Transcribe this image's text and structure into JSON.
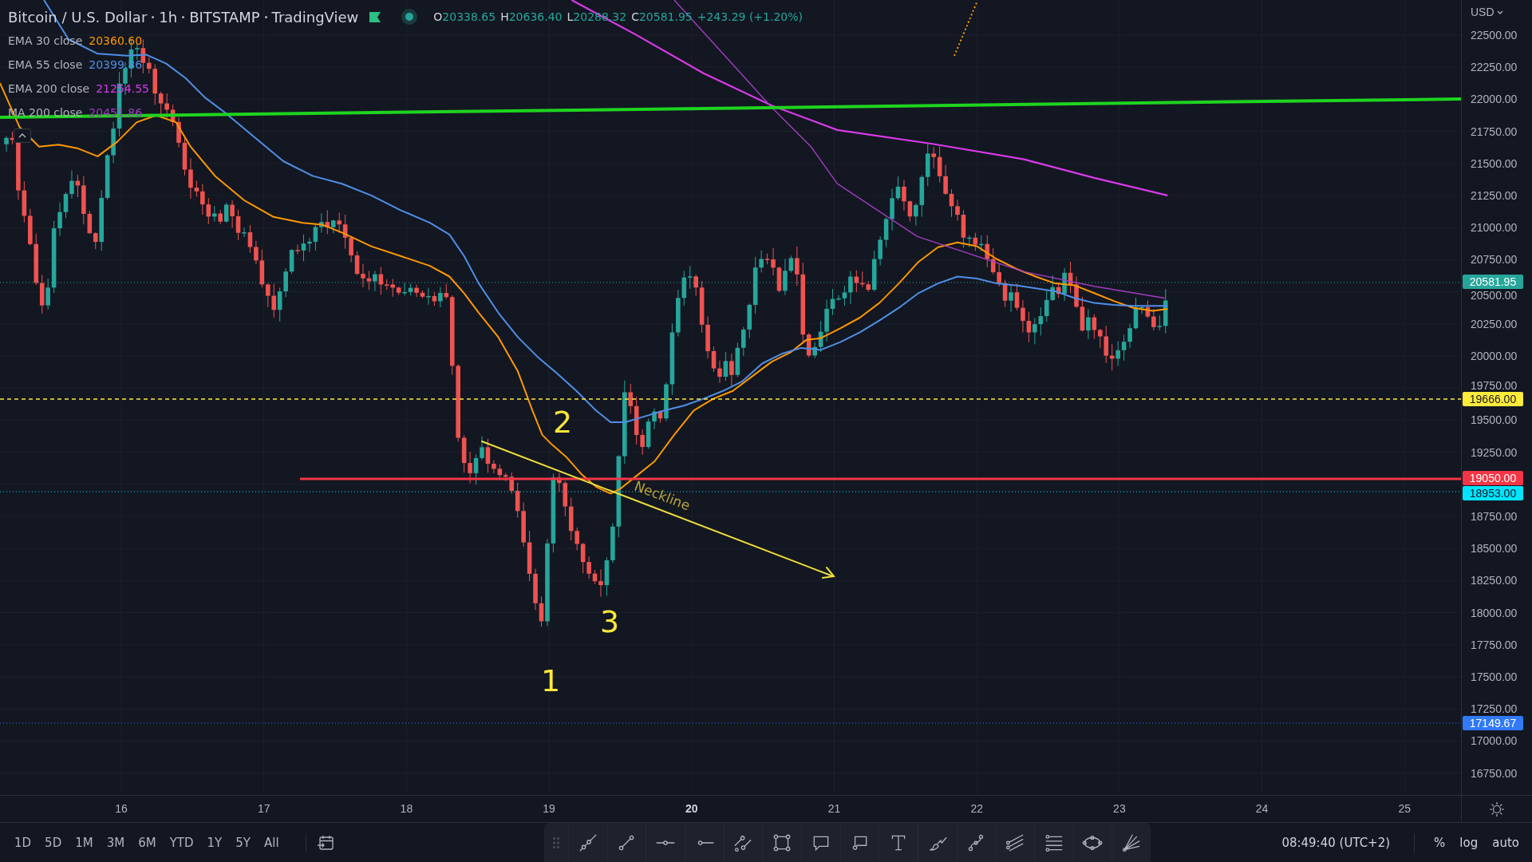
{
  "header": {
    "symbol": "Bitcoin / U.S. Dollar",
    "interval": "1h",
    "exchange": "BITSTAMP",
    "source": "TradingView",
    "rising": true,
    "ohlc": [
      {
        "label": "O",
        "value": "20338.65"
      },
      {
        "label": "H",
        "value": "20636.40"
      },
      {
        "label": "L",
        "value": "20288.32"
      },
      {
        "label": "C",
        "value": "20581.95"
      }
    ],
    "change": "+243.29 (+1.20%)"
  },
  "indicators": [
    {
      "name": "EMA 30 close",
      "value": "20360.60",
      "color": "#ff9800"
    },
    {
      "name": "EMA 55 close",
      "value": "20399.86",
      "color": "#4f8fe6"
    },
    {
      "name": "EMA 200 close",
      "value": "21254.55",
      "color": "#d93ae8"
    },
    {
      "name": "MA 200 close",
      "value": "20451.86",
      "color": "#a13cc0"
    }
  ],
  "annotations": [
    {
      "kind": "number",
      "text": "2"
    },
    {
      "kind": "label",
      "text": "Neckline"
    },
    {
      "kind": "number",
      "text": "3"
    },
    {
      "kind": "number",
      "text": "1"
    }
  ],
  "price_axis": {
    "currency": "USD",
    "labels": [
      "22500.00",
      "22250.00",
      "22000.00",
      "21750.00",
      "21500.00",
      "21250.00",
      "21000.00",
      "20750.00",
      "20500.00",
      "20250.00",
      "20000.00",
      "19750.00",
      "19500.00",
      "19250.00",
      "18750.00",
      "18500.00",
      "18250.00",
      "18000.00",
      "17750.00",
      "17500.00",
      "17250.00",
      "17000.00",
      "16750.00"
    ]
  },
  "price_tags": [
    {
      "value": "20581.95",
      "color": "#26a69a"
    },
    {
      "value": "19666.00",
      "color": "#ffeb3b"
    },
    {
      "value": "19050.00",
      "color": "#f23645"
    },
    {
      "value": "18953.00",
      "color": "#00e5ff"
    },
    {
      "value": "17149.67",
      "color": "#3179f5"
    }
  ],
  "time_axis": {
    "labels": [
      {
        "text": "16",
        "emphasized": false
      },
      {
        "text": "17",
        "emphasized": false
      },
      {
        "text": "18",
        "emphasized": false
      },
      {
        "text": "19",
        "emphasized": false
      },
      {
        "text": "20",
        "emphasized": true
      },
      {
        "text": "21",
        "emphasized": false
      },
      {
        "text": "22",
        "emphasized": false
      },
      {
        "text": "23",
        "emphasized": false
      },
      {
        "text": "24",
        "emphasized": false
      },
      {
        "text": "25",
        "emphasized": false
      }
    ]
  },
  "toolbar": {
    "ranges": [
      "1D",
      "5D",
      "1M",
      "3M",
      "6M",
      "YTD",
      "1Y",
      "5Y",
      "All"
    ],
    "clock": "08:49:40 (UTC+2)",
    "scale_options": [
      "%",
      "log",
      "auto"
    ]
  }
}
